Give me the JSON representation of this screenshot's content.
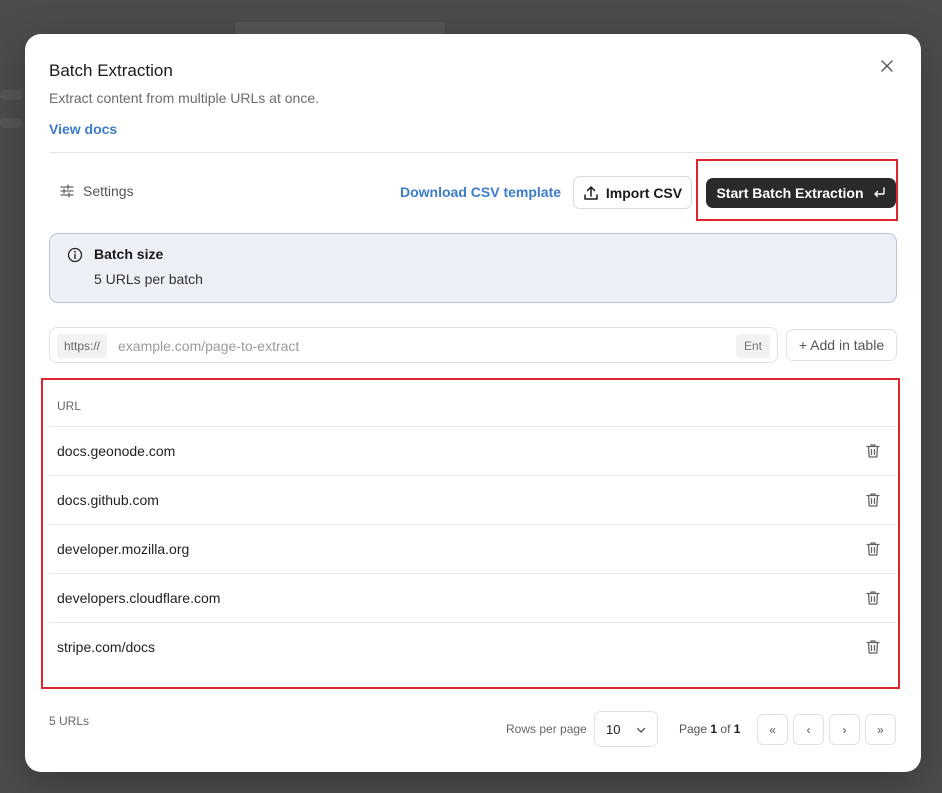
{
  "modal": {
    "title": "Batch Extraction",
    "subtitle": "Extract content from multiple URLs at once.",
    "docs_link": "View docs"
  },
  "toolbar": {
    "settings_label": "Settings",
    "csv_template_label": "Download CSV template",
    "import_label": "Import CSV",
    "start_label": "Start Batch Extraction"
  },
  "info": {
    "title": "Batch size",
    "text": "5 URLs per batch"
  },
  "url_input": {
    "prefix": "https://",
    "placeholder": "example.com/page-to-extract",
    "shortcut": "Ent",
    "add_label": "+ Add in table"
  },
  "table": {
    "header": "URL",
    "rows": [
      "docs.geonode.com",
      "docs.github.com",
      "developer.mozilla.org",
      "developers.cloudflare.com",
      "stripe.com/docs"
    ]
  },
  "footer": {
    "count": "5 URLs",
    "rows_per_page_label": "Rows per page",
    "rows_per_page_value": "10",
    "page_prefix": "Page",
    "page_current": "1",
    "page_of": "of",
    "page_total": "1",
    "first": "«",
    "prev": "‹",
    "next": "›",
    "last": "»"
  },
  "colors": {
    "accent_link": "#3d7cc9",
    "primary_button": "#2a2a2a",
    "highlight": "#e0242e",
    "info_bg": "#edf1f7"
  }
}
